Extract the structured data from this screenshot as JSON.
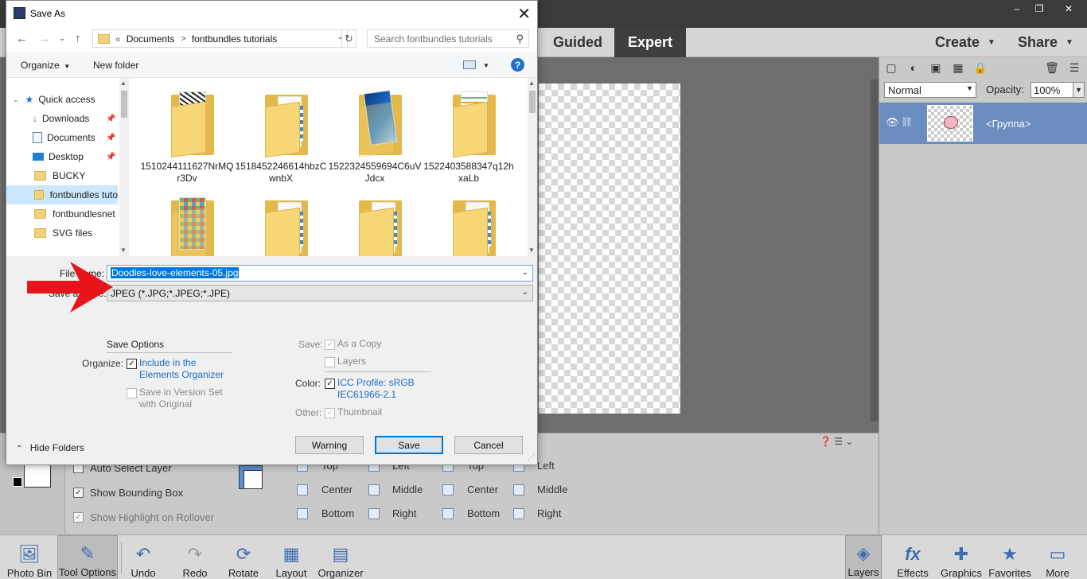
{
  "app": {
    "window_controls": {
      "minimize": "–",
      "restore": "❐",
      "close": "✕"
    },
    "modes": {
      "guided": "Guided",
      "expert": "Expert"
    },
    "create": "Create",
    "share": "Share",
    "layers_panel": {
      "blend_mode": "Normal",
      "opacity_label": "Opacity:",
      "opacity_value": "100%",
      "layer_name": "<Группа>"
    },
    "tool_options": {
      "auto_select_layer": "Auto Select Layer",
      "show_bounding_box": "Show Bounding Box",
      "show_highlight": "Show Highlight on Rollover",
      "align_top": "Top",
      "align_center": "Center",
      "align_bottom": "Bottom",
      "align_left": "Left",
      "align_middle": "Middle",
      "align_right": "Right",
      "dist_top": "Top",
      "dist_center": "Center",
      "dist_bottom": "Bottom",
      "dist_left": "Left",
      "dist_middle": "Middle",
      "dist_right": "Right"
    },
    "bottom_bar": {
      "photo_bin": "Photo Bin",
      "tool_options": "Tool Options",
      "undo": "Undo",
      "redo": "Redo",
      "rotate": "Rotate",
      "layout": "Layout",
      "organizer": "Organizer",
      "layers": "Layers",
      "effects": "Effects",
      "graphics": "Graphics",
      "favorites": "Favorites",
      "more": "More"
    }
  },
  "dialog": {
    "title": "Save As",
    "address": {
      "overflow": "«",
      "seg1": "Documents",
      "sep": ">",
      "seg2": "fontbundles tutorials"
    },
    "search_placeholder": "Search fontbundles tutorials",
    "organize": "Organize",
    "new_folder": "New folder",
    "help": "?",
    "nav_items": [
      {
        "label": "Quick access"
      },
      {
        "label": "Downloads"
      },
      {
        "label": "Documents"
      },
      {
        "label": "Desktop"
      },
      {
        "label": "BUCKY"
      },
      {
        "label": "fontbundles tuto"
      },
      {
        "label": "fontbundlesnet"
      },
      {
        "label": "SVG files"
      }
    ],
    "files": [
      {
        "name": "1510244111627NrMQr3Dv"
      },
      {
        "name": "1518452246614hbzCwnbX"
      },
      {
        "name": "1522324559694C6uVJdcx"
      },
      {
        "name": "1522403588347q12hxaLb"
      }
    ],
    "file_name_label": "File name:",
    "file_name_value": "Doodles-love-elements-05.jpg",
    "save_as_type_label": "Save as type:",
    "save_as_type_value": "JPEG (*.JPG;*.JPEG;*.JPE)",
    "save_options": {
      "heading": "Save Options",
      "organize_label": "Organize:",
      "include_in_organizer": "Include in the Elements Organizer",
      "include_line1": "Include in the",
      "include_line2": "Elements Organizer",
      "version_set_line1": "Save in Version Set",
      "version_set_line2": "with Original",
      "save_label": "Save:",
      "as_a_copy": "As a Copy",
      "layers": "Layers",
      "color_label": "Color:",
      "icc_line1": "ICC Profile:  sRGB",
      "icc_line2": "IEC61966-2.1",
      "other_label": "Other:",
      "thumbnail": "Thumbnail"
    },
    "hide_folders": "Hide Folders",
    "warning_button": "Warning",
    "save_button": "Save",
    "cancel_button": "Cancel"
  },
  "colors": {
    "annotation_arrow": "#e8141a",
    "accent_blue": "#0078d7",
    "layer_selected": "#6b8cbf"
  }
}
